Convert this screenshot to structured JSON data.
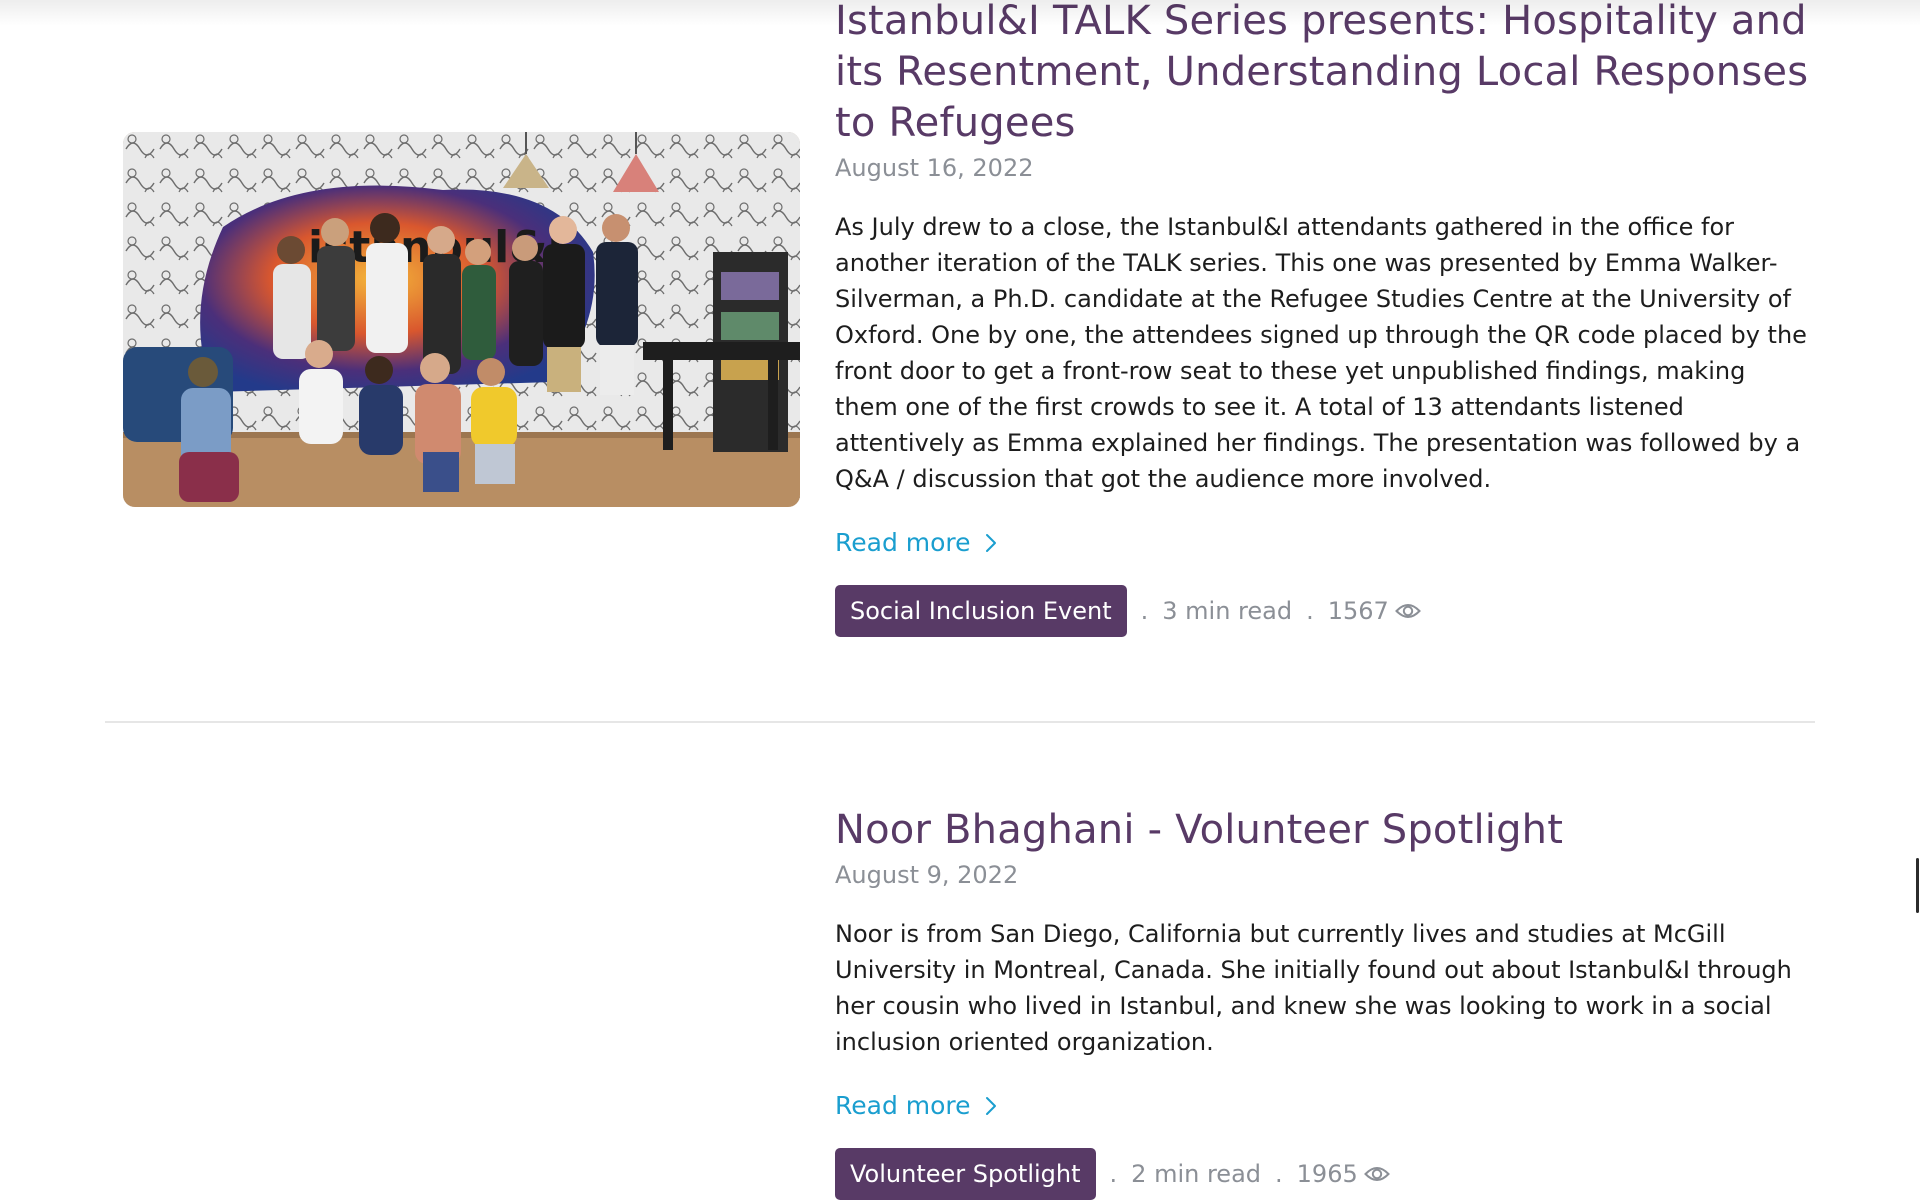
{
  "posts": [
    {
      "title": "Istanbul&I TALK Series presents: Hospitality and its Resentment, Understanding Local Responses to Refugees",
      "date": "August 16, 2022",
      "excerpt": "As July drew to a close, the Istanbul&I attendants gathered in the office for another iteration of the TALK series. This one was presented by Emma Walker-Silverman, a Ph.D. candidate at the Refugee Studies Centre at the University of Oxford. One by one, the attendees signed up through the QR code placed by the front door to get a front-row seat to these yet unpublished findings, making them one of the first crowds to see it. A total of 13 attendants listened attentively as Emma explained her findings. The presentation was followed by a Q&A / discussion that got the audience more involved.",
      "read_more": "Read more",
      "category": "Social Inclusion Event",
      "sep1": ".",
      "read_time": "3 min read",
      "sep2": ".",
      "views": "1567",
      "image_sign": "istanbul&i"
    },
    {
      "title": "Noor Bhaghani - Volunteer Spotlight",
      "date": "August 9, 2022",
      "excerpt": "Noor is from San Diego, California but currently lives  and studies at McGill University in Montreal, Canada. She initially found out about Istanbul&I through her cousin who lived in Istanbul, and knew she was looking to work in a social inclusion oriented organization.",
      "read_more": "Read more",
      "category": "Volunteer Spotlight",
      "sep1": ".",
      "read_time": "2 min read",
      "sep2": ".",
      "views": "1965"
    }
  ],
  "icons": {
    "read_more": "chevron-right-icon",
    "views": "eye-icon"
  },
  "colors": {
    "title": "#583a66",
    "tag_bg": "#583a66",
    "link": "#1a9ecf",
    "muted": "#8b8f96"
  }
}
